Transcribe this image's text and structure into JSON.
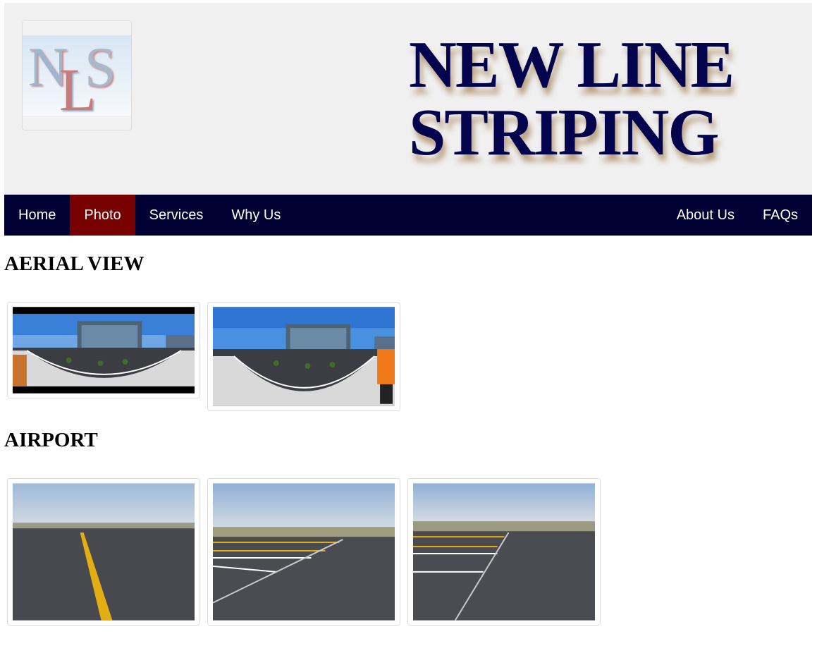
{
  "brand": {
    "logo_letters": [
      "N",
      "L",
      "S"
    ],
    "title_line1": "NEW LINE",
    "title_line2": "STRIPING"
  },
  "nav": {
    "left": [
      {
        "label": "Home",
        "active": false
      },
      {
        "label": "Photo",
        "active": true
      },
      {
        "label": "Services",
        "active": false
      },
      {
        "label": "Why Us",
        "active": false
      }
    ],
    "right": [
      {
        "label": "About Us",
        "active": false
      },
      {
        "label": "FAQs",
        "active": false
      }
    ]
  },
  "sections": [
    {
      "title": "AERIAL VIEW",
      "photos": [
        "aerial-panorama-photo",
        "aerial-panorama-photo"
      ]
    },
    {
      "title": "AIRPORT",
      "photos": [
        "airport-tarmac-photo",
        "airport-tarmac-photo",
        "airport-tarmac-photo"
      ]
    }
  ],
  "colors": {
    "header_bg": "#f0f0f0",
    "nav_bg": "#000033",
    "nav_active": "#770000",
    "brand_text": "#03044d"
  }
}
